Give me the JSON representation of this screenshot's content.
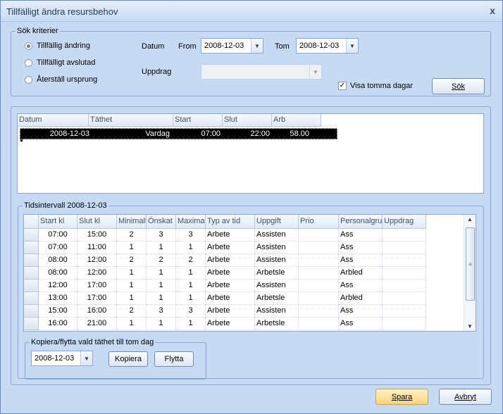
{
  "window": {
    "title": "Tillfälligt ändra resursbehov",
    "close_glyph": "x"
  },
  "search": {
    "legend": "Sök kriterier",
    "radios": [
      {
        "label": "Tillfällig ändring",
        "checked": true
      },
      {
        "label": "Tillfälligt avslutad",
        "checked": false
      },
      {
        "label": "Återställ ursprung",
        "checked": false
      }
    ],
    "datum_label": "Datum",
    "from_label": "From",
    "from_value": "2008-12-03",
    "tom_label": "Tom",
    "tom_value": "2008-12-03",
    "uppdrag_label": "Uppdrag",
    "uppdrag_value": "",
    "show_empty_label": "Visa tomma dagar",
    "show_empty_checked": true,
    "search_button": "Sök"
  },
  "days_grid": {
    "columns": [
      "Datum",
      "Täthet",
      "Start",
      "Slut",
      "Arb"
    ],
    "rows": [
      {
        "datum": "2008-12-03",
        "tathet": "Vardag",
        "start": "07:00",
        "slut": "22:00",
        "arb": "58.00"
      }
    ]
  },
  "intervals": {
    "legend": "Tidsintervall 2008-12-03",
    "columns": [
      "Start kl",
      "Slut kl",
      "Minimalt",
      "Önskat",
      "Maximal",
      "Typ av tid",
      "Uppgift",
      "Prio",
      "Personalgru",
      "Uppdrag"
    ],
    "rows": [
      [
        "07:00",
        "15:00",
        "2",
        "3",
        "3",
        "Arbete",
        "Assisten",
        "",
        "Ass",
        ""
      ],
      [
        "07:00",
        "11:00",
        "1",
        "1",
        "1",
        "Arbete",
        "Assisten",
        "",
        "Ass",
        ""
      ],
      [
        "08:00",
        "12:00",
        "2",
        "2",
        "2",
        "Arbete",
        "Assisten",
        "",
        "Ass",
        ""
      ],
      [
        "08:00",
        "12:00",
        "1",
        "1",
        "1",
        "Arbete",
        "Arbetsle",
        "",
        "Arbled",
        ""
      ],
      [
        "12:00",
        "17:00",
        "1",
        "1",
        "1",
        "Arbete",
        "Assisten",
        "",
        "Ass",
        ""
      ],
      [
        "13:00",
        "17:00",
        "1",
        "1",
        "1",
        "Arbete",
        "Arbetsle",
        "",
        "Arbled",
        ""
      ],
      [
        "15:00",
        "16:00",
        "2",
        "3",
        "3",
        "Arbete",
        "Assisten",
        "",
        "Ass",
        ""
      ],
      [
        "16:00",
        "21:00",
        "1",
        "1",
        "1",
        "Arbete",
        "Arbetsle",
        "",
        "Ass",
        ""
      ]
    ]
  },
  "copy": {
    "legend": "Kopiera/flytta vald täthet till tom dag",
    "date_value": "2008-12-03",
    "copy_button": "Kopiera",
    "move_button": "Flytta"
  },
  "footer": {
    "save_button": "Spara",
    "cancel_button": "Avbryt"
  }
}
